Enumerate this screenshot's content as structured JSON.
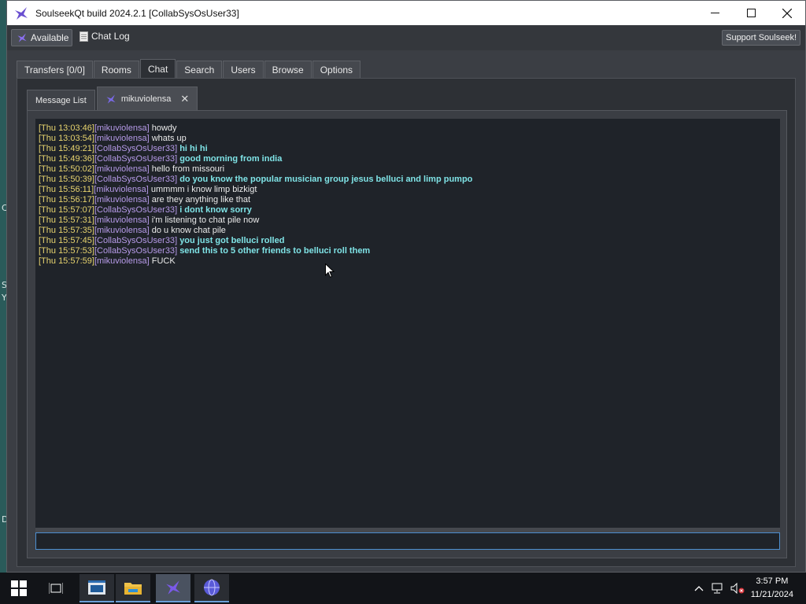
{
  "window": {
    "title": "SoulseekQt build 2024.2.1 [CollabSysOsUser33]"
  },
  "toolbar": {
    "status_label": "Available",
    "chat_log_label": "Chat Log",
    "support_label": "Support Soulseek!"
  },
  "main_tabs": [
    {
      "label": "Transfers [0/0]"
    },
    {
      "label": "Rooms"
    },
    {
      "label": "Chat"
    },
    {
      "label": "Search"
    },
    {
      "label": "Users"
    },
    {
      "label": "Browse"
    },
    {
      "label": "Options"
    }
  ],
  "chat": {
    "message_list_label": "Message List",
    "partner_tab_label": "mikuviolensa",
    "input_value": ""
  },
  "messages": [
    {
      "time": "[Thu 13:03:46]",
      "user": "mikuviolensa",
      "text": "howdy",
      "mine": false
    },
    {
      "time": "[Thu 13:03:54]",
      "user": "mikuviolensa",
      "text": "whats up",
      "mine": false
    },
    {
      "time": "[Thu 15:49:21]",
      "user": "CollabSysOsUser33",
      "text": "hi hi hi",
      "mine": true
    },
    {
      "time": "[Thu 15:49:36]",
      "user": "CollabSysOsUser33",
      "text": "good morning  from india",
      "mine": true
    },
    {
      "time": "[Thu 15:50:02]",
      "user": "mikuviolensa",
      "text": "hello from missouri",
      "mine": false
    },
    {
      "time": "[Thu 15:50:39]",
      "user": "CollabSysOsUser33",
      "text": "do you know the popular musician group jesus belluci and limp pumpo",
      "mine": true
    },
    {
      "time": "[Thu 15:56:11]",
      "user": "mikuviolensa",
      "text": "ummmm i know limp bizkigt",
      "mine": false
    },
    {
      "time": "[Thu 15:56:17]",
      "user": "mikuviolensa",
      "text": "are they anything like that",
      "mine": false
    },
    {
      "time": "[Thu 15:57:07]",
      "user": "CollabSysOsUser33",
      "text": "i dont know sorry",
      "mine": true
    },
    {
      "time": "[Thu 15:57:31]",
      "user": "mikuviolensa",
      "text": "i'm listening to chat pile now",
      "mine": false
    },
    {
      "time": "[Thu 15:57:35]",
      "user": "mikuviolensa",
      "text": "do u know chat pile",
      "mine": false
    },
    {
      "time": "[Thu 15:57:45]",
      "user": "CollabSysOsUser33",
      "text": "you just got belluci rolled",
      "mine": true
    },
    {
      "time": "[Thu 15:57:53]",
      "user": "CollabSysOsUser33",
      "text": "send this to 5 other friends to belluci roll them",
      "mine": true
    },
    {
      "time": "[Thu 15:57:59]",
      "user": "mikuviolensa",
      "text": "FUCK",
      "mine": false
    }
  ],
  "desktop_edge": [
    "C",
    "S",
    "Y",
    "D"
  ],
  "taskbar": {
    "time": "3:57 PM",
    "date": "11/21/2024"
  },
  "colors": {
    "timestamp": "#e8d46e",
    "username": "#b69ae8",
    "own_text": "#7fe3e6",
    "other_text": "#eaeaea",
    "input_focus": "#4c8ed0"
  }
}
